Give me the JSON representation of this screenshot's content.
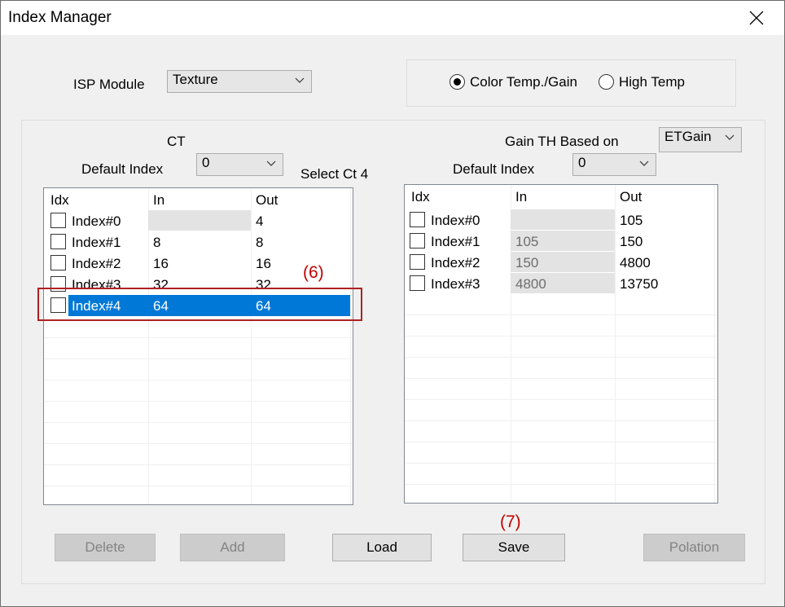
{
  "window": {
    "title": "Index Manager"
  },
  "isp": {
    "label": "ISP Module",
    "value": "Texture"
  },
  "mode": {
    "option1": "Color Temp./Gain",
    "option2": "High Temp",
    "selected": "Color Temp./Gain"
  },
  "left": {
    "title": "CT",
    "default_label": "Default Index",
    "default_value": "0",
    "select_label": "Select Ct 4",
    "columns": [
      "Idx",
      "In",
      "Out"
    ],
    "rows": [
      {
        "idx": "Index#0",
        "in": "",
        "out": "4"
      },
      {
        "idx": "Index#1",
        "in": "8",
        "out": "8"
      },
      {
        "idx": "Index#2",
        "in": "16",
        "out": "16"
      },
      {
        "idx": "Index#3",
        "in": "32",
        "out": "32"
      },
      {
        "idx": "Index#4",
        "in": "64",
        "out": "64"
      }
    ]
  },
  "right": {
    "gain_label": "Gain TH Based on",
    "gain_value": "ETGain",
    "default_label": "Default Index",
    "default_value": "0",
    "columns": [
      "Idx",
      "In",
      "Out"
    ],
    "rows": [
      {
        "idx": "Index#0",
        "in": "",
        "out": "105"
      },
      {
        "idx": "Index#1",
        "in": "105",
        "out": "150"
      },
      {
        "idx": "Index#2",
        "in": "150",
        "out": "4800"
      },
      {
        "idx": "Index#3",
        "in": "4800",
        "out": "13750"
      }
    ]
  },
  "buttons": {
    "delete": "Delete",
    "add": "Add",
    "load": "Load",
    "save": "Save",
    "polation": "Polation"
  },
  "annotations": {
    "a6": "(6)",
    "a7": "(7)"
  }
}
